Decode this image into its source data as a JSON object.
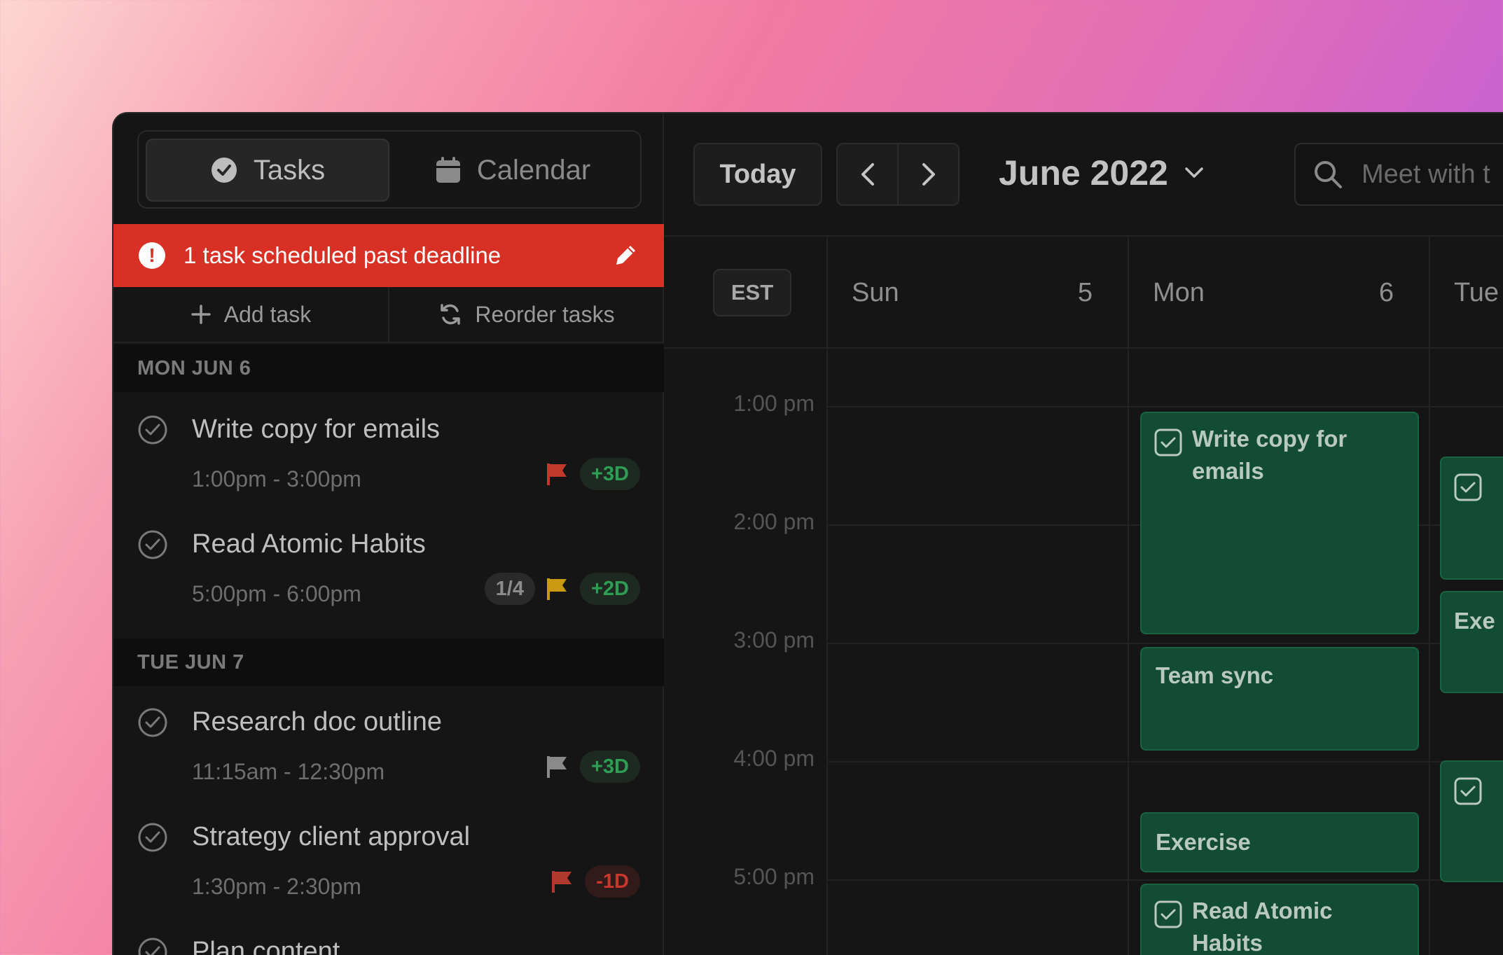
{
  "sidebar": {
    "tabs": [
      {
        "label": "Tasks",
        "icon": "check-circle-icon",
        "active": true
      },
      {
        "label": "Calendar",
        "icon": "calendar-icon",
        "active": false
      }
    ],
    "alert": {
      "text": "1 task scheduled past deadline",
      "icon": "exclamation-icon",
      "action_icon": "pencil-icon",
      "color": "#d93025"
    },
    "actions": {
      "add_task": "Add task",
      "reorder_tasks": "Reorder tasks"
    },
    "groups": [
      {
        "day": "MON JUN 6",
        "tasks": [
          {
            "title": "Write copy for emails",
            "time": "1:00pm - 3:00pm",
            "flag": "#c0392b",
            "badge": "+3D",
            "badge_type": "green"
          },
          {
            "title": "Read Atomic Habits",
            "time": "5:00pm - 6:00pm",
            "progress": "1/4",
            "flag": "#c99a10",
            "badge": "+2D",
            "badge_type": "green"
          }
        ]
      },
      {
        "day": "TUE JUN 7",
        "tasks": [
          {
            "title": "Research doc outline",
            "time": "11:15am - 12:30pm",
            "flag": "#8a8a8a",
            "badge": "+3D",
            "badge_type": "green"
          },
          {
            "title": "Strategy client approval",
            "time": "1:30pm - 2:30pm",
            "flag": "#b03a2e",
            "badge": "-1D",
            "badge_type": "red"
          },
          {
            "title": "Plan content",
            "time": "",
            "flag": "",
            "badge": "",
            "badge_type": ""
          }
        ]
      }
    ]
  },
  "calendar": {
    "today_label": "Today",
    "month_label": "June 2022",
    "search_placeholder": "Meet with t",
    "timezone": "EST",
    "days": [
      {
        "name": "Sun",
        "date": "5"
      },
      {
        "name": "Mon",
        "date": "6"
      },
      {
        "name": "Tue",
        "date": ""
      }
    ],
    "hours": [
      "1:00 pm",
      "2:00 pm",
      "3:00 pm",
      "4:00 pm",
      "5:00 pm"
    ],
    "events": [
      {
        "title": "Write copy for emails",
        "task": true
      },
      {
        "title": "Team sync",
        "task": false
      },
      {
        "title": "Exercise",
        "task": false
      },
      {
        "title": "Read Atomic Habits",
        "task": true
      },
      {
        "title": "",
        "task": true
      },
      {
        "title": "Exe",
        "task": false
      },
      {
        "title": "",
        "task": true
      }
    ],
    "event_color": "#124c35"
  }
}
